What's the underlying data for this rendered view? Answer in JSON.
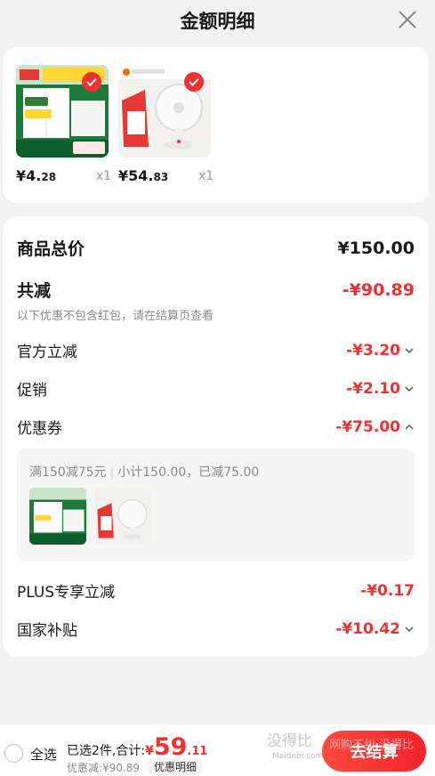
{
  "header": {
    "title": "金额明细"
  },
  "products": [
    {
      "price_int": "¥4.",
      "price_dec": "28",
      "qty": "x1"
    },
    {
      "price_int": "¥54.",
      "price_dec": "83",
      "qty": "x1"
    }
  ],
  "detail": {
    "total_label": "商品总价",
    "total_value": "¥150.00",
    "reduce_label": "共减",
    "reduce_value": "-¥90.89",
    "reduce_note": "以下优惠不包含红包，请在结算页查看",
    "rows": [
      {
        "label": "官方立减",
        "value": "-¥3.20"
      },
      {
        "label": "促销",
        "value": "-¥2.10"
      },
      {
        "label": "优惠券",
        "value": "-¥75.00"
      },
      {
        "label": "PLUS专享立减",
        "value": "-¥0.17"
      },
      {
        "label": "国家补贴",
        "value": "-¥10.42"
      }
    ],
    "coupon": {
      "rule": "满150减75元",
      "subtotal": "小计150.00，已减75.00"
    }
  },
  "bottom": {
    "select_all": "全选",
    "selected_prefix": "已选2件,合计:",
    "total_yen": "¥",
    "total_int": "59",
    "total_dec": ".11",
    "discount_text": "优惠减:¥90.89",
    "detail_button": "优惠明细",
    "checkout_button": "去结算",
    "watermark": "没得比",
    "watermark_site": "Meidebi.com",
    "watermark_overlay": "网购不纠·没得比"
  },
  "colors": {
    "accent": "#f23030",
    "background": "#f2f2f2"
  }
}
